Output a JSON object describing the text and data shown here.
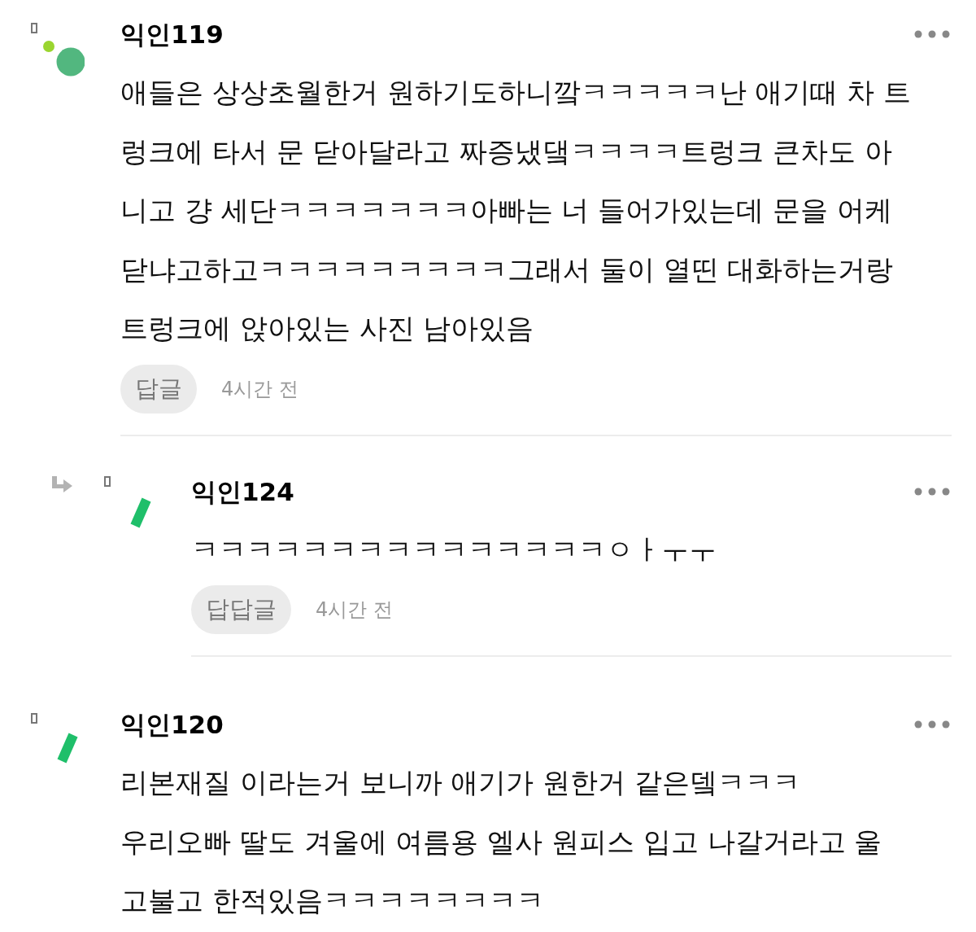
{
  "comments": [
    {
      "author": "익인119",
      "avatar": {
        "kind": "dots"
      },
      "body_lines": [
        "애들은 상상초월한거 원하기도하니깤ㅋㅋㅋㅋㅋ난 애기때 차 트",
        "렁크에 타서 문 닫아달라고 짜증냈댘ㅋㅋㅋㅋ트렁크 큰차도 아",
        "니고 걍 세단ㅋㅋㅋㅋㅋㅋㅋ아빠는 너 들어가있는데 문을 어케",
        "닫냐고하고ㅋㅋㅋㅋㅋㅋㅋㅋㅋ그래서 둘이 열띤 대화하는거랑",
        "트렁크에 앉아있는 사진 남아있음"
      ],
      "reply_label": "답글",
      "time": "4시간 전",
      "replies": [
        {
          "author": "익인124",
          "avatar": {
            "kind": "bar"
          },
          "body_lines": [
            "ㅋㅋㅋㅋㅋㅋㅋㅋㅋㅋㅋㅋㅋㅋㅋㅇㅏㅜㅜ"
          ],
          "reply_label": "답답글",
          "time": "4시간 전"
        }
      ]
    },
    {
      "author": "익인120",
      "avatar": {
        "kind": "bar"
      },
      "body_lines": [
        "리본재질 이라는거 보니까 애기가 원한거 같은뎈ㅋㅋㅋ",
        "우리오빠 딸도 겨울에 여름용 엘사 원피스 입고 나갈거라고 울",
        "고불고 한적있음ㅋㅋㅋㅋㅋㅋㅋㅋ"
      ]
    }
  ]
}
